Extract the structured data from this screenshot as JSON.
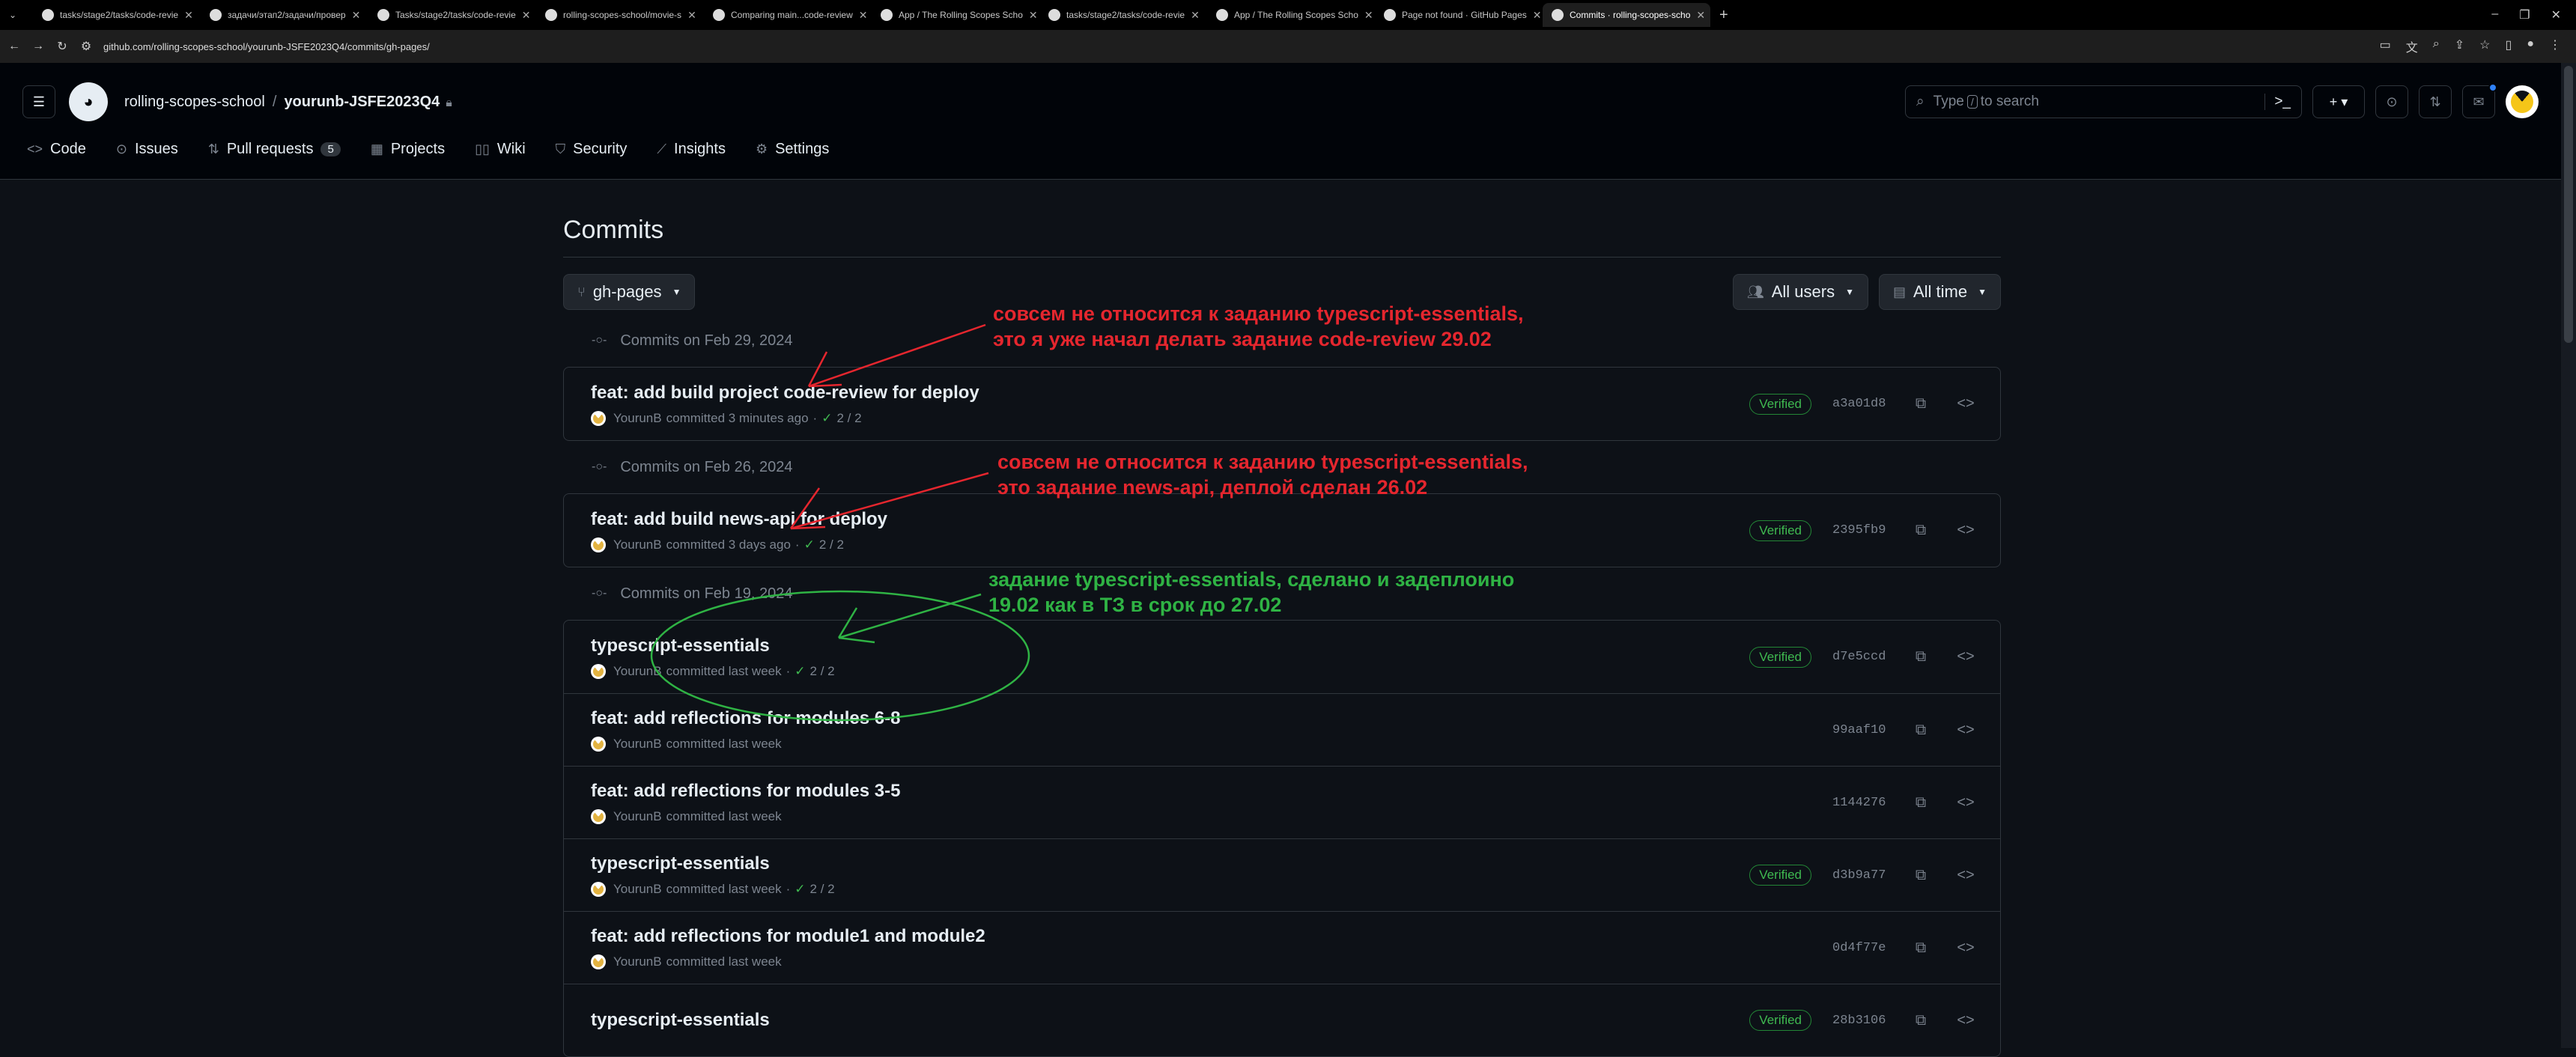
{
  "browser": {
    "tabs": [
      {
        "title": "tasks/stage2/tasks/code-revie",
        "active": false
      },
      {
        "title": "задачи/этап2/задачи/провер",
        "active": false
      },
      {
        "title": "Tasks/stage2/tasks/code-revie",
        "active": false
      },
      {
        "title": "rolling-scopes-school/movie-s",
        "active": false
      },
      {
        "title": "Comparing main...code-review",
        "active": false
      },
      {
        "title": "App / The Rolling Scopes Scho",
        "active": false
      },
      {
        "title": "tasks/stage2/tasks/code-revie",
        "active": false
      },
      {
        "title": "App / The Rolling Scopes Scho",
        "active": false
      },
      {
        "title": "Page not found · GitHub Pages",
        "active": false
      },
      {
        "title": "Commits · rolling-scopes-scho",
        "active": true
      }
    ],
    "url": "github.com/rolling-scopes-school/yourunb-JSFE2023Q4/commits/gh-pages/"
  },
  "header": {
    "org": "rolling-scopes-school",
    "repo": "yourunb-JSFE2023Q4",
    "search_placeholder_pre": "Type",
    "search_key": "/",
    "search_placeholder_post": "to search"
  },
  "repo_nav": {
    "code": "Code",
    "issues": "Issues",
    "pulls": "Pull requests",
    "pulls_count": "5",
    "projects": "Projects",
    "wiki": "Wiki",
    "security": "Security",
    "insights": "Insights",
    "settings": "Settings"
  },
  "page": {
    "title": "Commits",
    "branch": "gh-pages",
    "users_filter": "All users",
    "time_filter": "All time"
  },
  "groups": [
    {
      "date": "Commits on Feb 29, 2024",
      "commits": [
        {
          "title": "feat: add build project code-review for deploy",
          "author": "YourunB",
          "when": "committed 3 minutes ago",
          "checks": "2 / 2",
          "verified": "Verified",
          "sha": "a3a01d8"
        }
      ]
    },
    {
      "date": "Commits on Feb 26, 2024",
      "commits": [
        {
          "title": "feat: add build news-api for deploy",
          "author": "YourunB",
          "when": "committed 3 days ago",
          "checks": "2 / 2",
          "verified": "Verified",
          "sha": "2395fb9"
        }
      ]
    },
    {
      "date": "Commits on Feb 19, 2024",
      "commits": [
        {
          "title": "typescript-essentials",
          "author": "YourunB",
          "when": "committed last week",
          "checks": "2 / 2",
          "verified": "Verified",
          "sha": "d7e5ccd"
        },
        {
          "title": "feat: add reflections for modules 6-8",
          "author": "YourunB",
          "when": "committed last week",
          "checks": "",
          "verified": "",
          "sha": "99aaf10"
        },
        {
          "title": "feat: add reflections for modules 3-5",
          "author": "YourunB",
          "when": "committed last week",
          "checks": "",
          "verified": "",
          "sha": "1144276"
        },
        {
          "title": "typescript-essentials",
          "author": "YourunB",
          "when": "committed last week",
          "checks": "2 / 2",
          "verified": "Verified",
          "sha": "d3b9a77"
        },
        {
          "title": "feat: add reflections for module1 and module2",
          "author": "YourunB",
          "when": "committed last week",
          "checks": "",
          "verified": "",
          "sha": "0d4f77e"
        },
        {
          "title": "typescript-essentials",
          "author": "",
          "when": "",
          "checks": "",
          "verified": "Verified",
          "sha": "28b3106"
        }
      ]
    }
  ],
  "annotations": {
    "a1_line1": "совсем не относится к заданию typescript-essentials,",
    "a1_line2": "это я уже начал делать задание code-review 29.02",
    "a2_line1": "совсем не относится к заданию typescript-essentials,",
    "a2_line2": "это задание news-api, деплой сделан 26.02",
    "a3_line1": "задание typescript-essentials, сделано и задеплоино",
    "a3_line2": "19.02 как в ТЗ в срок до 27.02",
    "colors": {
      "red": "#e5262e",
      "green": "#2fb344"
    }
  }
}
